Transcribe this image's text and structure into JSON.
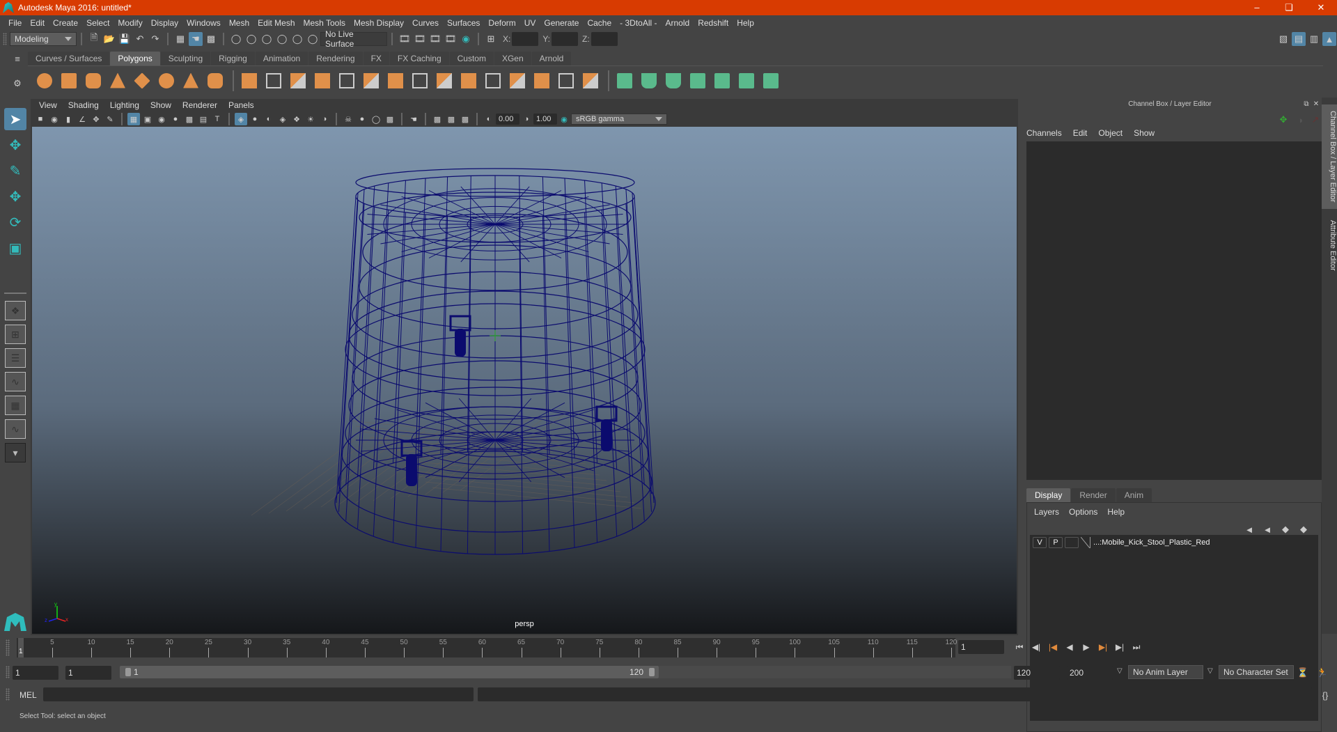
{
  "window": {
    "title": "Autodesk Maya 2016: untitled*",
    "controls": [
      "minimize-icon",
      "restore-icon",
      "close-icon"
    ]
  },
  "menubar": [
    "File",
    "Edit",
    "Create",
    "Select",
    "Modify",
    "Display",
    "Windows",
    "Mesh",
    "Edit Mesh",
    "Mesh Tools",
    "Mesh Display",
    "Curves",
    "Surfaces",
    "Deform",
    "UV",
    "Generate",
    "Cache",
    "- 3DtoAll -",
    "Arnold",
    "Redshift",
    "Help"
  ],
  "statusline": {
    "menuset": "Modeling",
    "live_surface": "No Live Surface",
    "x_label": "X:",
    "y_label": "Y:",
    "z_label": "Z:",
    "x_value": "",
    "y_value": "",
    "z_value": ""
  },
  "shelf": {
    "tabs": [
      "Curves / Surfaces",
      "Polygons",
      "Sculpting",
      "Rigging",
      "Animation",
      "Rendering",
      "FX",
      "FX Caching",
      "Custom",
      "XGen",
      "Arnold"
    ],
    "active_tab": "Polygons",
    "icons": [
      "poly-sphere-icon",
      "poly-cube-icon",
      "poly-cylinder-icon",
      "poly-cone-icon",
      "poly-plane-icon",
      "poly-torus-icon",
      "poly-pyramid-icon",
      "poly-pipe-icon",
      "combine-icon",
      "separate-icon",
      "mirror-icon",
      "smooth-icon",
      "bevel-icon",
      "extrude-icon",
      "bridge-icon",
      "multi-cut-icon",
      "target-weld-icon",
      "fill-hole-icon",
      "insert-edge-loop-icon",
      "offset-edge-loop-icon",
      "merge-icon",
      "bridge-edge-icon",
      "append-icon",
      "planar-uv-icon",
      "cylindrical-uv-icon",
      "spherical-uv-icon",
      "automatic-uv-icon",
      "unfold-uv-icon",
      "uv-editor-icon",
      "cut-sew-uv-icon"
    ]
  },
  "colors": {
    "titlebar": "#d83b01",
    "selection": "#5285a6",
    "wireframe": "#0b0b6e",
    "shelf_orange": "#e0904a",
    "shelf_green": "#5aba8c",
    "accent_teal": "#33b5b5"
  },
  "toolbox": {
    "tools": [
      "select-tool",
      "lasso-tool",
      "paint-select-tool",
      "move-tool",
      "rotate-tool",
      "scale-tool"
    ],
    "selected": "select-tool"
  },
  "panel": {
    "menu": [
      "View",
      "Shading",
      "Lighting",
      "Show",
      "Renderer",
      "Panels"
    ],
    "exposure": "0.00",
    "gamma": "1.00",
    "color_space": "sRGB gamma",
    "camera_label": "persp",
    "axis_labels": {
      "x": "x",
      "y": "y",
      "z": "z"
    }
  },
  "channel_box": {
    "title": "Channel Box / Layer Editor",
    "menu": [
      "Channels",
      "Edit",
      "Object",
      "Show"
    ]
  },
  "layer_editor": {
    "tabs": [
      "Display",
      "Render",
      "Anim"
    ],
    "active_tab": "Display",
    "menu": [
      "Layers",
      "Options",
      "Help"
    ],
    "layers": [
      {
        "visible": "V",
        "playback": "P",
        "name": "...:Mobile_Kick_Stool_Plastic_Red"
      }
    ]
  },
  "side_tabs": [
    "Channel Box / Layer Editor",
    "Attribute Editor"
  ],
  "timeline": {
    "start": 1,
    "end": 120,
    "current_frame": "1",
    "tick_labels": [
      "5",
      "10",
      "15",
      "20",
      "25",
      "30",
      "35",
      "40",
      "45",
      "50",
      "55",
      "60",
      "65",
      "70",
      "75",
      "80",
      "85",
      "90",
      "95",
      "100",
      "105",
      "110",
      "115",
      "120"
    ]
  },
  "range": {
    "start_time": "1",
    "playback_start": "1",
    "slider_start": "1",
    "slider_end": "120",
    "playback_end": "120",
    "end_time": "200",
    "anim_layer": "No Anim Layer",
    "character_set": "No Character Set"
  },
  "command_line": {
    "label": "MEL",
    "value": ""
  },
  "help_line": "Select Tool: select an object"
}
